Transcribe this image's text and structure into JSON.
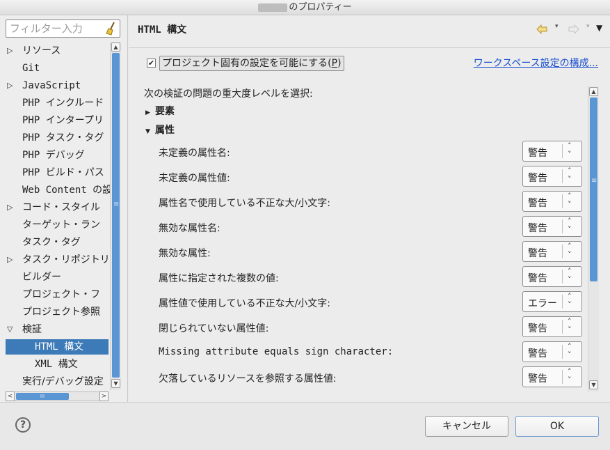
{
  "window": {
    "title": "のプロパティー"
  },
  "filter": {
    "placeholder": "フィルター入力"
  },
  "tree": [
    {
      "label": "リソース",
      "twisty": "▷"
    },
    {
      "label": "Git",
      "twisty": ""
    },
    {
      "label": "JavaScript",
      "twisty": "▷"
    },
    {
      "label": "PHP インクルード",
      "twisty": ""
    },
    {
      "label": "PHP インタープリ",
      "twisty": ""
    },
    {
      "label": "PHP タスク・タグ",
      "twisty": ""
    },
    {
      "label": "PHP デバッグ",
      "twisty": ""
    },
    {
      "label": "PHP ビルド・パス",
      "twisty": ""
    },
    {
      "label": "Web Content の設",
      "twisty": ""
    },
    {
      "label": "コード・スタイル",
      "twisty": "▷"
    },
    {
      "label": "ターゲット・ラン",
      "twisty": ""
    },
    {
      "label": "タスク・タグ",
      "twisty": ""
    },
    {
      "label": "タスク・リポジトリ",
      "twisty": "▷"
    },
    {
      "label": "ビルダー",
      "twisty": ""
    },
    {
      "label": "プロジェクト・フ",
      "twisty": ""
    },
    {
      "label": "プロジェクト参照",
      "twisty": ""
    },
    {
      "label": "検証",
      "twisty": "▽"
    },
    {
      "label": "HTML 構文",
      "twisty": "",
      "child": true,
      "selected": true
    },
    {
      "label": "XML 構文",
      "twisty": "",
      "child": true
    },
    {
      "label": "実行/デバッグ設定",
      "twisty": ""
    }
  ],
  "header": {
    "title": "HTML 構文"
  },
  "project": {
    "checkbox_checked": true,
    "label": "プロジェクト固有の設定を可能にする(",
    "mnemonic": "P",
    "label_end": ")",
    "link": "ワークスペース設定の構成..."
  },
  "severity_label": "次の検証の問題の重大度レベルを選択:",
  "sections": {
    "elements": "要素",
    "attributes": "属性"
  },
  "rows": [
    {
      "label": "未定義の属性名:",
      "value": "警告"
    },
    {
      "label": "未定義の属性値:",
      "value": "警告"
    },
    {
      "label": "属性名で使用している不正な大/小文字:",
      "value": "警告"
    },
    {
      "label": "無効な属性名:",
      "value": "警告"
    },
    {
      "label": "無効な属性:",
      "value": "警告"
    },
    {
      "label": "属性に指定された複数の値:",
      "value": "警告"
    },
    {
      "label": "属性値で使用している不正な大/小文字:",
      "value": "エラー"
    },
    {
      "label": "閉じられていない属性値:",
      "value": "警告"
    },
    {
      "label": "Missing attribute equals sign character:",
      "value": "警告"
    },
    {
      "label": "欠落しているリソースを参照する属性値:",
      "value": "警告"
    }
  ],
  "buttons": {
    "cancel": "キャンセル",
    "ok": "OK",
    "help": "?"
  },
  "colors": {
    "selection": "#3d7ab8",
    "link": "#1a4fd0",
    "scroll_thumb": "#5a95d4"
  }
}
